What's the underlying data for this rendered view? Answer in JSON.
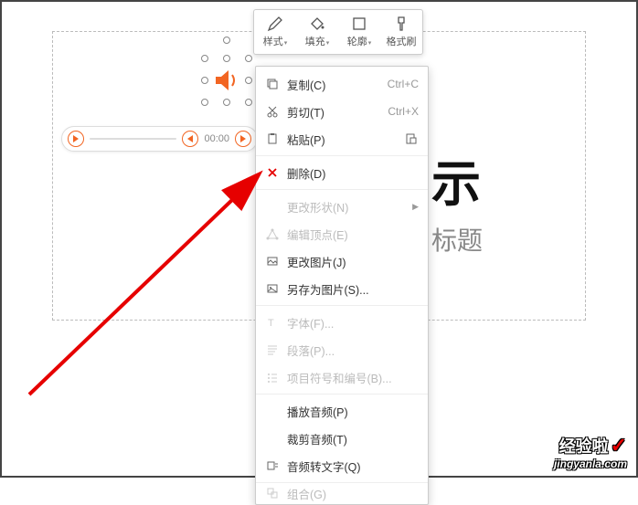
{
  "slide": {
    "big_text_fragment": "示",
    "sub_text_fragment": "标题"
  },
  "audio_player": {
    "time": "00:00"
  },
  "toolbar": {
    "items": [
      {
        "label": "样式",
        "icon": "pencil",
        "dropdown": true
      },
      {
        "label": "填充",
        "icon": "bucket",
        "dropdown": true
      },
      {
        "label": "轮廓",
        "icon": "rect",
        "dropdown": true
      },
      {
        "label": "格式刷",
        "icon": "brush",
        "dropdown": false
      }
    ]
  },
  "context_menu": {
    "items": [
      {
        "icon": "copy",
        "label": "复制(C)",
        "shortcut": "Ctrl+C",
        "interactable": true
      },
      {
        "icon": "cut",
        "label": "剪切(T)",
        "shortcut": "Ctrl+X",
        "interactable": true
      },
      {
        "icon": "paste",
        "label": "粘贴(P)",
        "shortcut": "",
        "right_icon": "paste-options",
        "interactable": true
      },
      {
        "sep": true
      },
      {
        "icon": "delete",
        "label": "删除(D)",
        "shortcut": "",
        "interactable": true,
        "red_icon": true
      },
      {
        "sep": true
      },
      {
        "icon": "",
        "label": "更改形状(N)",
        "submenu": true,
        "disabled": true
      },
      {
        "icon": "edit-points",
        "label": "编辑顶点(E)",
        "disabled": true
      },
      {
        "icon": "change-image",
        "label": "更改图片(J)",
        "interactable": true
      },
      {
        "icon": "save-image",
        "label": "另存为图片(S)...",
        "interactable": true
      },
      {
        "sep": true
      },
      {
        "icon": "font",
        "label": "字体(F)...",
        "disabled": true
      },
      {
        "icon": "paragraph",
        "label": "段落(P)...",
        "disabled": true
      },
      {
        "icon": "bullets",
        "label": "项目符号和编号(B)...",
        "disabled": true
      },
      {
        "sep": true
      },
      {
        "icon": "",
        "label": "播放音频(P)",
        "interactable": true
      },
      {
        "icon": "",
        "label": "裁剪音频(T)",
        "interactable": true
      },
      {
        "icon": "audio-text",
        "label": "音频转文字(Q)",
        "interactable": true
      },
      {
        "sep": true
      },
      {
        "icon": "group",
        "label": "组合(G)",
        "disabled": true,
        "cutoff": true
      }
    ]
  },
  "watermark": {
    "brand": "经验啦",
    "url": "jingyanla.com"
  }
}
